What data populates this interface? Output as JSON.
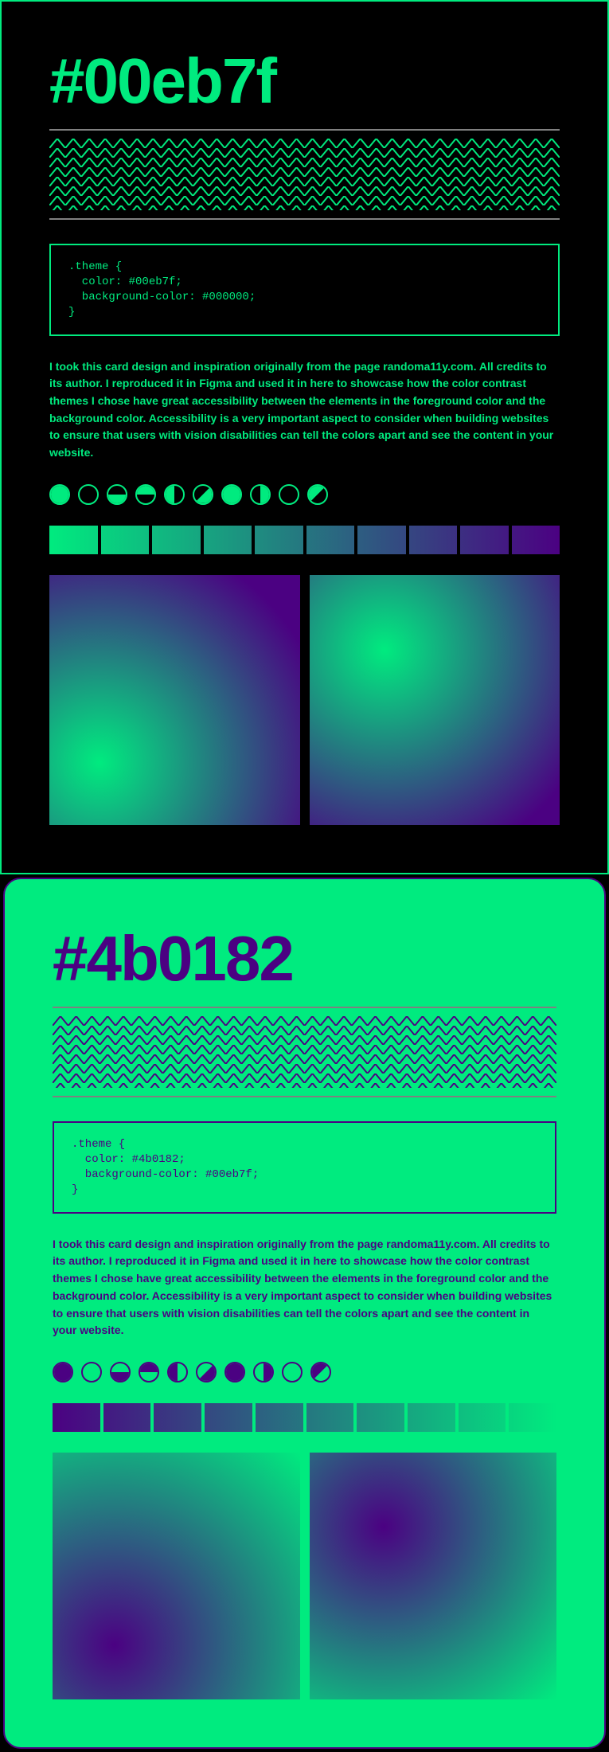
{
  "colors": {
    "green": "#00eb7f",
    "purple": "#4b0182",
    "black": "#000000"
  },
  "card1": {
    "title": "#00eb7f",
    "css": ".theme {\n  color: #00eb7f;\n  background-color: #000000;\n}",
    "body": "I took this card design and inspiration originally from the page randoma11y.com. All credits to its author. I reproduced it in Figma and used it in here to showcase how the color contrast themes I chose have great accessibility between the elements in the foreground color and the background color. Accessibility is a very important aspect to consider when building websites to ensure that users with vision disabilities can tell the colors apart and see the content in your website."
  },
  "card2": {
    "title": "#4b0182",
    "css": ".theme {\n  color: #4b0182;\n  background-color: #00eb7f;\n}",
    "body": "I took this card design and inspiration originally from the page randoma11y.com. All credits to its author. I reproduced it in Figma and used it in here to showcase how the color contrast themes I chose have great accessibility between the elements in the foreground color and the background color. Accessibility is a very important aspect to consider when building websites to ensure that users with vision disabilities can tell the colors apart and see the content in your website."
  }
}
